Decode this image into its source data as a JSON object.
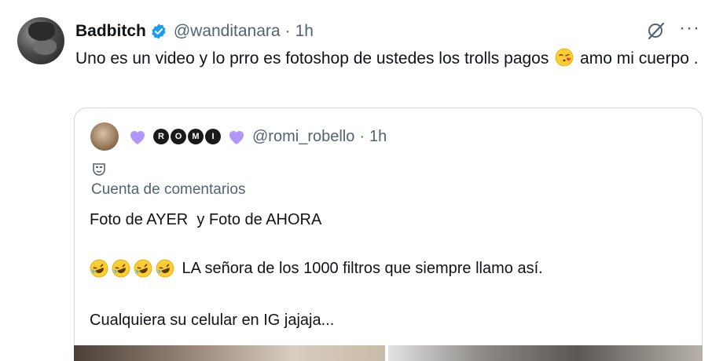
{
  "tweet": {
    "author_name": "Badbitch",
    "handle": "@wanditanara",
    "separator": "·",
    "time": "1h",
    "text_before_emoji": "Uno es un video y lo prro es fotoshop de ustedes los trolls pagos ",
    "text_after_emoji": " amo mi cuerpo .",
    "more_label": "···"
  },
  "quote": {
    "handle": "@romi_robello",
    "separator": "·",
    "time": "1h",
    "name_letters": [
      "R",
      "O",
      "M",
      "I"
    ],
    "label": "Cuenta de comentarios",
    "line1": "Foto de AYER  y Foto de AHORA",
    "line2": " LA señora de los 1000 filtros que siempre llamo así.",
    "line3": "Cualquiera su celular en IG jajaja..."
  },
  "colors": {
    "verified": "#1d9bf0",
    "heart": "#b197fc",
    "secondary_text": "#536471",
    "border": "#cfd9de"
  },
  "icons": [
    "verified-badge-icon",
    "grok-icon",
    "more-icon",
    "kiss-emoji-icon",
    "purple-heart-icon",
    "mask-icon",
    "laughing-emoji-icon"
  ]
}
